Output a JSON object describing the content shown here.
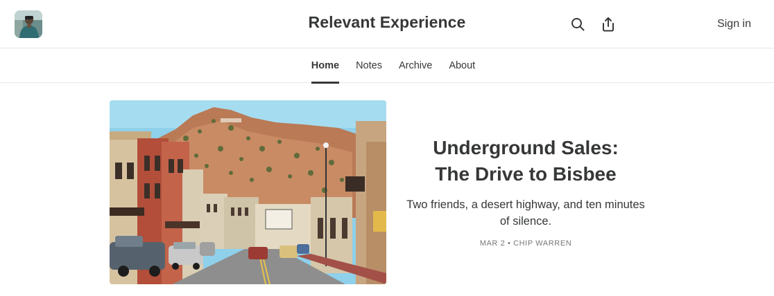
{
  "header": {
    "title": "Relevant Experience",
    "sign_in_label": "Sign in",
    "icons": [
      "avatar",
      "search-icon",
      "share-icon"
    ]
  },
  "nav": {
    "tabs": [
      {
        "label": "Home",
        "active": true
      },
      {
        "label": "Notes",
        "active": false
      },
      {
        "label": "Archive",
        "active": false
      },
      {
        "label": "About",
        "active": false
      }
    ]
  },
  "featured_post": {
    "title_line1": "Underground Sales:",
    "title_line2": "The Drive to Bisbee",
    "subtitle": "Two friends, a desert highway, and ten minutes of silence.",
    "date": "MAR 2",
    "separator": "•",
    "author": "CHIP WARREN"
  },
  "colors": {
    "text": "#363737",
    "meta": "#777777",
    "divider": "#e6e6e6"
  }
}
